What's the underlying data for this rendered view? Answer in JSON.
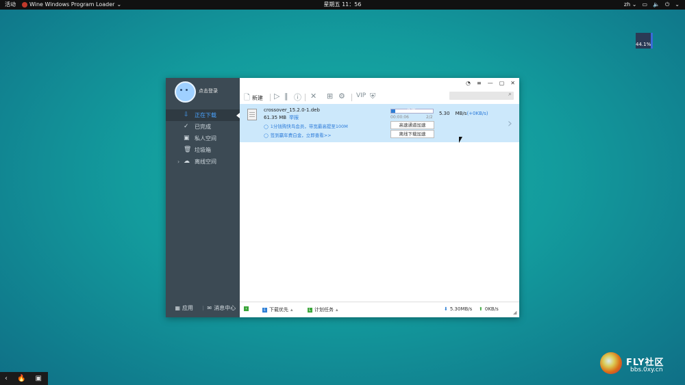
{
  "topbar": {
    "activities": "活动",
    "app_title": "Wine Windows Program Loader",
    "clock": "星期五 11：56",
    "lang": "zh"
  },
  "widget": {
    "percent": "44.1%"
  },
  "sidebar": {
    "login": "点击登录",
    "items": [
      {
        "label": "正在下载"
      },
      {
        "label": "已完成"
      },
      {
        "label": "私人空间"
      },
      {
        "label": "垃圾箱"
      },
      {
        "label": "离线空间"
      }
    ],
    "bottom": {
      "apps": "应用",
      "messages": "消息中心"
    }
  },
  "toolbar": {
    "new": "新建"
  },
  "task": {
    "filename": "crossover_15.2.0-1.deb",
    "size": "61.35 MB",
    "tag": "举报",
    "promo1": "1分钱购快鸟会员，带宽最高提至100M",
    "promo2": "签到赢年费白金，立即查看>>",
    "progress_label": "9.2%",
    "progress": 0.092,
    "time": "00:00:06",
    "count": "2/2",
    "btn_high": "高速通道加速",
    "btn_offline": "离线下载加速",
    "speed": "5.30",
    "unit": "MB/s",
    "up": "(+0KB/s)"
  },
  "statusbar": {
    "priority": "下载优先",
    "plan": "计划任务",
    "down": "5.30MB/s",
    "up": "0KB/s"
  },
  "watermark": {
    "title": "FLY社区",
    "url": "bbs.0xy.cn"
  }
}
